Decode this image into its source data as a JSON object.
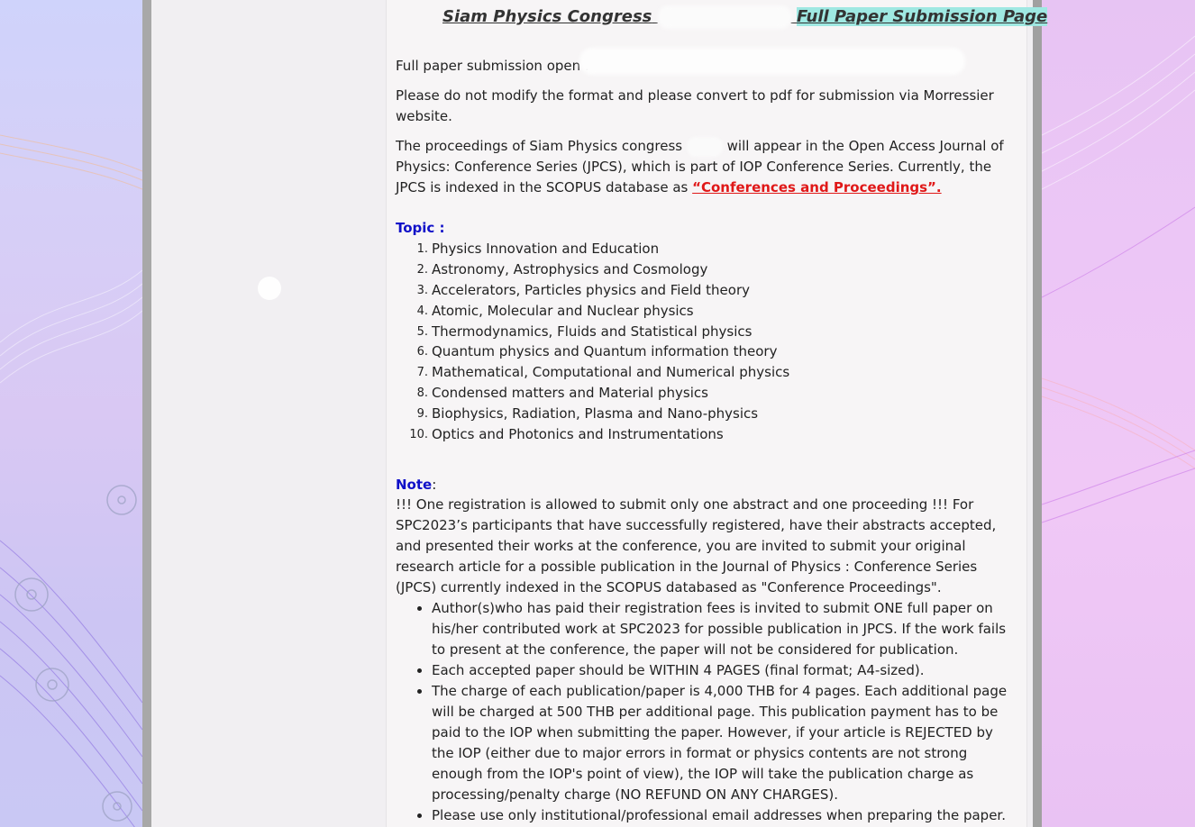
{
  "header": {
    "title_left": "Siam Physics Congress",
    "title_right": "Full Paper Submission Page"
  },
  "intro": {
    "submission_open": "Full paper submission open :",
    "format_note": "Please do not modify the format and please convert to pdf for submission via Morressier website.",
    "proceedings_a": "The proceedings of Siam Physics congress",
    "proceedings_b": "will appear in the Open Access Journal of Physics: Conference Series (JPCS), which is part of IOP Conference Series. Currently, the JPCS is indexed in the SCOPUS database as",
    "proceedings_link": "“Conferences and Proceedings”."
  },
  "topics": {
    "heading": "Topic :",
    "items": [
      {
        "num": "1.",
        "label": "Physics Innovation and Education"
      },
      {
        "num": "2.",
        "label": "Astronomy, Astrophysics and Cosmology"
      },
      {
        "num": "3.",
        "label": "Accelerators, Particles physics and Field theory"
      },
      {
        "num": "4.",
        "label": "Atomic, Molecular and Nuclear physics"
      },
      {
        "num": "5.",
        "label": "Thermodynamics, Fluids and Statistical physics"
      },
      {
        "num": "6.",
        "label": "Quantum physics and Quantum information theory"
      },
      {
        "num": "7.",
        "label": "Mathematical, Computational and Numerical physics"
      },
      {
        "num": "8.",
        "label": "Condensed matters and Material physics"
      },
      {
        "num": "9.",
        "label": "Biophysics, Radiation, Plasma and Nano-physics"
      },
      {
        "num": "10.",
        "label": "Optics and Photonics and Instrumentations"
      }
    ]
  },
  "note": {
    "heading": "Note",
    "colon": ":",
    "paragraph": "!!! One registration is allowed to submit only one abstract and one proceeding !!!  For SPC2023’s participants that have successfully registered, have their abstracts accepted, and presented their works at the conference, you are invited to submit your original research article for a possible publication in the Journal of Physics : Conference Series (JPCS) currently indexed in the SCOPUS databased as \"Conference Proceedings\".",
    "bullets": [
      "Author(s)who has paid their registration fees is invited to submit ONE full paper on his/her contributed work at SPC2023 for possible publication in JPCS. If the work fails to present at the conference, the paper will not be considered for publication.",
      "Each accepted paper should be WITHIN 4 PAGES (final format; A4-sized).",
      "The charge of each publication/paper is 4,000 THB for 4 pages. Each additional page will be charged at 500 THB per additional page. This publication payment has to be paid to the IOP when submitting the paper. However, if your article is REJECTED by the IOP (either due to major errors in format or physics contents are not strong enough from the IOP's point of view), the IOP will take the publication charge as processing/penalty charge (NO REFUND ON ANY CHARGES).",
      "Please use only institutional/professional email addresses when preparing the paper."
    ]
  },
  "colors": {
    "link_red": "#e01818",
    "heading_blue": "#1010c8",
    "title_highlight": "#9fe8e2"
  }
}
